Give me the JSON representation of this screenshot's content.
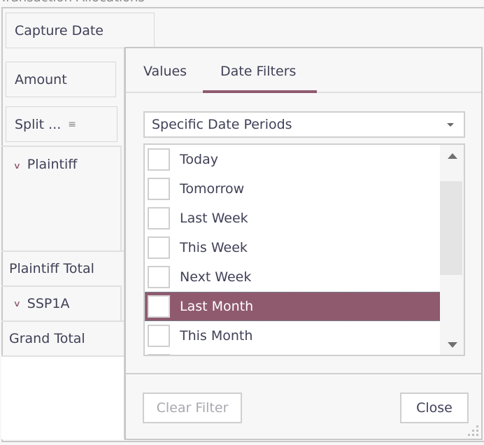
{
  "window": {
    "title_partial": "Transaction Allocations"
  },
  "pivot": {
    "filter_fields": [
      "Capture Date"
    ],
    "data_fields": [
      "Amount"
    ],
    "column_fields": [
      {
        "label": "Split ...",
        "icon": "sort-icon"
      }
    ],
    "rows": [
      {
        "label": "Plaintiff",
        "expanded": true
      },
      {
        "label": "Plaintiff Total"
      },
      {
        "label": "SSP1A",
        "expanded": true
      },
      {
        "label": "Grand Total"
      }
    ]
  },
  "filter_popup": {
    "tabs": [
      {
        "label": "Values",
        "active": false
      },
      {
        "label": "Date Filters",
        "active": true
      }
    ],
    "dropdown": {
      "selected": "Specific Date Periods"
    },
    "list_items": [
      {
        "label": "Today",
        "checked": false,
        "selected": false
      },
      {
        "label": "Tomorrow",
        "checked": false,
        "selected": false
      },
      {
        "label": "Last Week",
        "checked": false,
        "selected": false
      },
      {
        "label": "This Week",
        "checked": false,
        "selected": false
      },
      {
        "label": "Next Week",
        "checked": false,
        "selected": false
      },
      {
        "label": "Last Month",
        "checked": false,
        "selected": true
      },
      {
        "label": "This Month",
        "checked": false,
        "selected": false
      }
    ],
    "buttons": {
      "clear_filter": "Clear Filter",
      "close": "Close"
    }
  },
  "colors": {
    "accent": "#8f5a6e",
    "text": "#404058",
    "disabled_text": "#a8a8b0",
    "background": "#f7f7f7",
    "border": "#cfcfcf"
  }
}
